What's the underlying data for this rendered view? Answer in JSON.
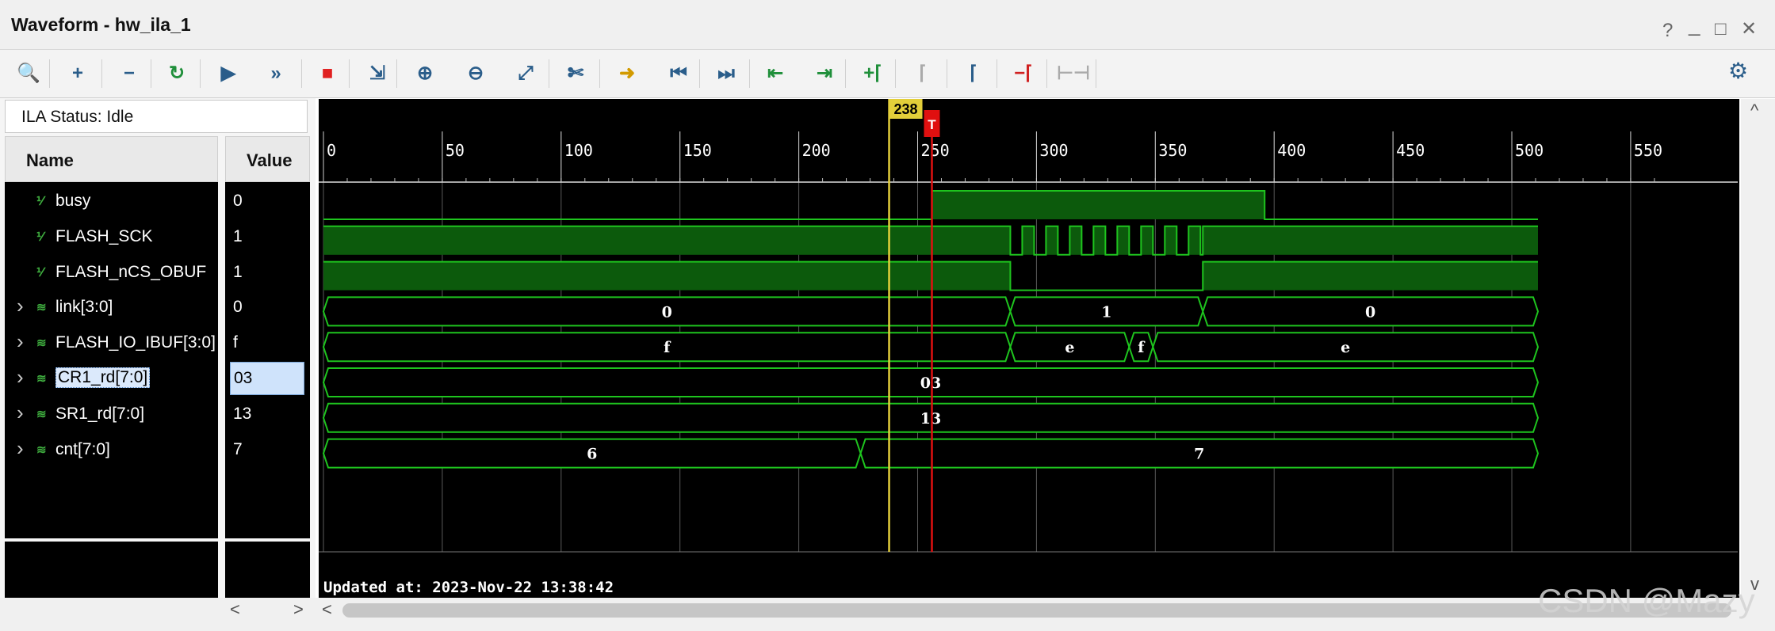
{
  "window": {
    "title": "Waveform - hw_ila_1",
    "help": "?",
    "minimize": "_",
    "maximize": "□",
    "close": "✕"
  },
  "toolbar": {
    "icons": [
      {
        "name": "search-icon",
        "glyph": "🔍",
        "color": "#2a5d8a"
      },
      {
        "name": "add-icon",
        "glyph": "+",
        "color": "#2a5d8a"
      },
      {
        "name": "remove-icon",
        "glyph": "−",
        "color": "#2a5d8a"
      },
      {
        "name": "run-trigger-immediate-icon",
        "glyph": "↻",
        "color": "#1f8f3a"
      },
      {
        "name": "run-trigger-icon",
        "glyph": "▶",
        "color": "#2a5d8a"
      },
      {
        "name": "run-continuous-icon",
        "glyph": "»",
        "color": "#2a5d8a"
      },
      {
        "name": "stop-icon",
        "glyph": "■",
        "color": "#e02020"
      },
      {
        "name": "export-icon",
        "glyph": "⇲",
        "color": "#2a5d8a"
      },
      {
        "name": "zoom-in-icon",
        "glyph": "⊕",
        "color": "#2a5d8a"
      },
      {
        "name": "zoom-out-icon",
        "glyph": "⊖",
        "color": "#2a5d8a"
      },
      {
        "name": "zoom-fit-icon",
        "glyph": "⤢",
        "color": "#2a5d8a"
      },
      {
        "name": "snap-icon",
        "glyph": "✄",
        "color": "#2a5d8a"
      },
      {
        "name": "goto-cursor-icon",
        "glyph": "➜",
        "color": "#d29a00"
      },
      {
        "name": "goto-start-icon",
        "glyph": "⏮",
        "color": "#2a5d8a"
      },
      {
        "name": "goto-end-icon",
        "glyph": "⏭",
        "color": "#2a5d8a"
      },
      {
        "name": "previous-transition-icon",
        "glyph": "⇤",
        "color": "#1f8f3a"
      },
      {
        "name": "next-transition-icon",
        "glyph": "⇥",
        "color": "#1f8f3a"
      },
      {
        "name": "add-marker-icon",
        "glyph": "+⌈",
        "color": "#1f8f3a"
      },
      {
        "name": "previous-marker-icon",
        "glyph": "⌈",
        "color": "#aaaaaa"
      },
      {
        "name": "next-marker-icon",
        "glyph": "⌈",
        "color": "#2a5d8a"
      },
      {
        "name": "delete-marker-icon",
        "glyph": "−⌈",
        "color": "#d02020"
      },
      {
        "name": "swap-cursors-icon",
        "glyph": "⊢⊣",
        "color": "#aaaaaa"
      }
    ],
    "settings_icon": "gear-icon"
  },
  "ila_status": "ILA Status: Idle",
  "columns": {
    "name": "Name",
    "value": "Value"
  },
  "signals": [
    {
      "name": "busy",
      "value": "0",
      "kind": "bit",
      "expandable": false
    },
    {
      "name": "FLASH_SCK",
      "value": "1",
      "kind": "bit",
      "expandable": false
    },
    {
      "name": "FLASH_nCS_OBUF",
      "value": "1",
      "kind": "bit",
      "expandable": false
    },
    {
      "name": "link[3:0]",
      "value": "0",
      "kind": "bus",
      "expandable": true
    },
    {
      "name": "FLASH_IO_IBUF[3:0]",
      "value": "f",
      "kind": "bus",
      "expandable": true
    },
    {
      "name": "CR1_rd[7:0]",
      "value": "03",
      "kind": "bus",
      "expandable": true,
      "selected": true
    },
    {
      "name": "SR1_rd[7:0]",
      "value": "13",
      "kind": "bus",
      "expandable": true
    },
    {
      "name": "cnt[7:0]",
      "value": "7",
      "kind": "bus",
      "expandable": true
    }
  ],
  "timeline": {
    "ticks": [
      "0",
      "50",
      "100",
      "150",
      "200",
      "250",
      "300",
      "350",
      "400",
      "450",
      "500",
      "550"
    ],
    "tick_values": [
      0,
      50,
      100,
      150,
      200,
      250,
      300,
      350,
      400,
      450,
      500,
      550
    ],
    "start": 0,
    "end": 511
  },
  "cursor": {
    "label": "238",
    "value": 238
  },
  "trigger": {
    "label": "T",
    "value": 256
  },
  "waveforms": {
    "busy": {
      "type": "bit",
      "transitions": [
        [
          0,
          0
        ],
        [
          256,
          1
        ],
        [
          396,
          0
        ]
      ]
    },
    "FLASH_SCK": {
      "type": "bit",
      "transitions": [
        [
          0,
          1
        ],
        [
          289,
          0
        ],
        [
          294,
          1
        ],
        [
          299,
          0
        ],
        [
          304,
          1
        ],
        [
          309,
          0
        ],
        [
          314,
          1
        ],
        [
          319,
          0
        ],
        [
          324,
          1
        ],
        [
          329,
          0
        ],
        [
          334,
          1
        ],
        [
          339,
          0
        ],
        [
          344,
          1
        ],
        [
          349,
          0
        ],
        [
          354,
          1
        ],
        [
          359,
          0
        ],
        [
          364,
          1
        ],
        [
          369,
          0
        ],
        [
          370,
          1
        ]
      ]
    },
    "FLASH_nCS_OBUF": {
      "type": "bit",
      "transitions": [
        [
          0,
          1
        ],
        [
          289,
          0
        ],
        [
          370,
          1
        ]
      ]
    },
    "link[3:0]": {
      "type": "bus",
      "segments": [
        [
          0,
          289,
          "0"
        ],
        [
          289,
          370,
          "1"
        ],
        [
          370,
          511,
          "0"
        ]
      ]
    },
    "FLASH_IO_IBUF[3:0]": {
      "type": "bus",
      "segments": [
        [
          0,
          289,
          "f"
        ],
        [
          289,
          339,
          "e"
        ],
        [
          339,
          349,
          "f"
        ],
        [
          349,
          511,
          "e"
        ]
      ]
    },
    "CR1_rd[7:0]": {
      "type": "bus",
      "segments": [
        [
          0,
          511,
          "03"
        ]
      ]
    },
    "SR1_rd[7:0]": {
      "type": "bus",
      "segments": [
        [
          0,
          511,
          "13"
        ]
      ]
    },
    "cnt[7:0]": {
      "type": "bus",
      "segments": [
        [
          0,
          226,
          "6"
        ],
        [
          226,
          511,
          "7"
        ]
      ]
    }
  },
  "updated_at": "Updated at: 2023-Nov-22 13:38:42",
  "scroll": {
    "left": "<",
    "right": ">",
    "up": "^",
    "down": "v"
  },
  "watermark": "CSDN @Mazy",
  "colors": {
    "wave": "#1ec41e",
    "wave_fill": "#0c5a0c",
    "bus_text": "#ffffff",
    "cursor": "#e3cf3a",
    "trigger": "#e01010",
    "grid": "#5a5a5a"
  }
}
